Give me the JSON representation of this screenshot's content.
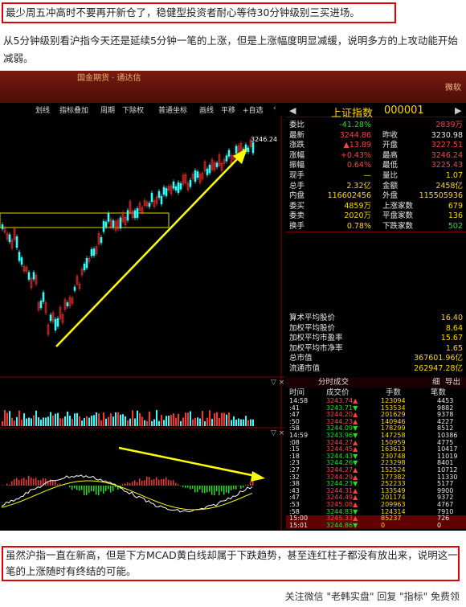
{
  "note_top": "最少周五冲高时不要再开新仓了，稳健型投资者耐心等待30分钟级别三买进场。",
  "paragraph": "从5分钟级别看沪指今天还是延续5分钟一笔的上涨，但是上涨幅度明显减缓，说明多方的上攻动能开始减弱。",
  "window_title": "国金期货 · 通达信",
  "window_right": "微软",
  "chart_toolbar": [
    "划线",
    "指标叠加",
    "周期",
    "下除权",
    "普通坐标",
    "画线",
    "平移",
    "+自选"
  ],
  "chart_price_label": "3246.24",
  "quote": {
    "name": "上证指数",
    "code": "000001",
    "rows": [
      {
        "l": "委比",
        "v": "-41.28%",
        "l2": "",
        "v2": "2839万"
      },
      {
        "l": "最新",
        "v": "3244.86",
        "l2": "昨收",
        "v2": "3230.98"
      },
      {
        "l": "涨跌",
        "v": "▲13.89",
        "l2": "开盘",
        "v2": "3227.51"
      },
      {
        "l": "涨幅",
        "v": "+0.43%",
        "l2": "最高",
        "v2": "3246.24"
      },
      {
        "l": "振幅",
        "v": "0.64%",
        "l2": "最低",
        "v2": "3225.43"
      },
      {
        "l": "现手",
        "v": "—",
        "l2": "量比",
        "v2": "1.07"
      },
      {
        "l": "总手",
        "v": "2.32亿",
        "l2": "金额",
        "v2": "2458亿"
      },
      {
        "l": "内盘",
        "v": "116602456",
        "l2": "外盘",
        "v2": "115505936"
      },
      {
        "l": "委买",
        "v": "4859万",
        "l2": "上涨家数",
        "v2": "679"
      },
      {
        "l": "委卖",
        "v": "2020万",
        "l2": "平盘家数",
        "v2": "136"
      },
      {
        "l": "换手",
        "v": "0.78%",
        "l2": "下跌家数",
        "v2": "502"
      }
    ],
    "stats": [
      {
        "l": "算术平均股价",
        "v": "16.40"
      },
      {
        "l": "加权平均股价",
        "v": "8.64"
      },
      {
        "l": "加权平均市盈率",
        "v": "15.67"
      },
      {
        "l": "加权平均市净率",
        "v": "1.65"
      },
      {
        "l": "总市值",
        "v": "367601.96亿"
      },
      {
        "l": "流通市值",
        "v": "262947.28亿"
      }
    ]
  },
  "trades_title": "分时成交",
  "trades_buttons": [
    "细",
    "导出"
  ],
  "trades_headers": [
    "时间",
    "成交价",
    "手数",
    "笔数"
  ],
  "trades": [
    [
      "14:58",
      "3243.74▲",
      "123094",
      "4453"
    ],
    [
      ":41",
      "3243.71▼",
      "153534",
      "9882"
    ],
    [
      ":47",
      "3244.20▲",
      "201629",
      "9378"
    ],
    [
      ":50",
      "3244.23▲",
      "140946",
      "4227"
    ],
    [
      ":58",
      "3244.09▼",
      "178299",
      "8512"
    ],
    [
      "14:59",
      "3243.96▼",
      "147258",
      "10386"
    ],
    [
      ":08",
      "3244.27▲",
      "150959",
      "4775"
    ],
    [
      ":15",
      "3244.45▲",
      "163613",
      "10417"
    ],
    [
      ":18",
      "3244.43▼",
      "230748",
      "11019"
    ],
    [
      ":23",
      "3244.26▼",
      "223298",
      "8401"
    ],
    [
      ":27",
      "3244.27▲",
      "152524",
      "10712"
    ],
    [
      ":32",
      "3244.29▲",
      "177382",
      "11330"
    ],
    [
      ":38",
      "3244.23▼",
      "252233",
      "5177"
    ],
    [
      ":43",
      "3244.31▲",
      "133549",
      "9900"
    ],
    [
      ":47",
      "3244.49▲",
      "201174",
      "9372"
    ],
    [
      ":53",
      "3245.08▲",
      "209963",
      "4767"
    ],
    [
      ":58",
      "3244.83▼",
      "124314",
      "7910"
    ],
    [
      "15:00",
      "3245.33▲",
      "85237",
      "726"
    ],
    [
      "15:01",
      "3244.86▼",
      "0",
      "0"
    ]
  ],
  "note_bottom": "虽然沪指一直在新高，但是下方MCAD黄白线却属于下跌趋势，甚至连红柱子都没有放出来，说明这一笔的上涨随时有终结的可能。",
  "watermark": "关注微信 \"老韩实盘\" 回复 \"指标\" 免费领",
  "colors": {
    "up": "#ff4040",
    "down": "#20e020",
    "arrow": "#ffff00",
    "frame": "#e00000"
  }
}
